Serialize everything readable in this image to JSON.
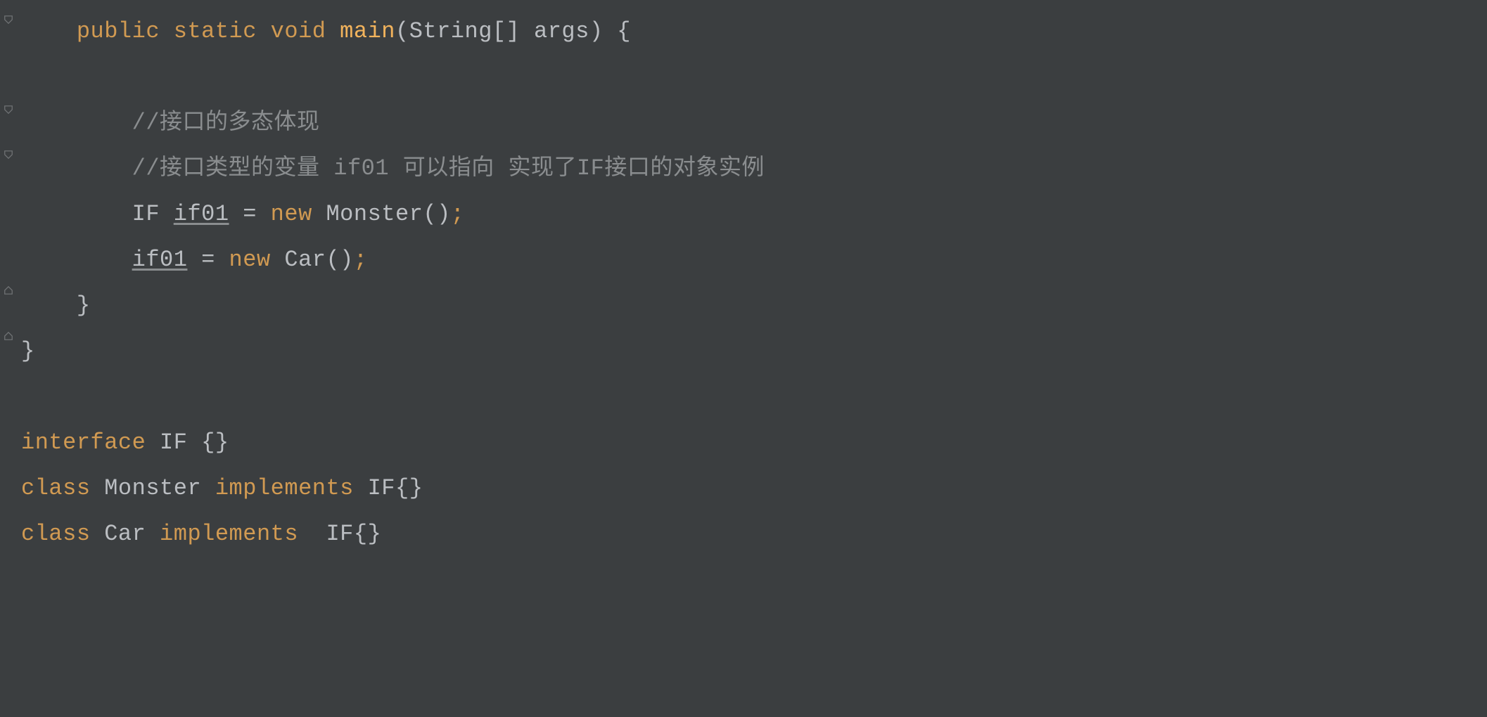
{
  "code": {
    "line1": {
      "kw_public": "public",
      "kw_static": "static",
      "kw_void": "void",
      "method": "main",
      "paren_open": "(",
      "type_string": "String",
      "brackets": "[]",
      "arg": " args",
      "paren_close": ")",
      "brace": " {"
    },
    "line3": {
      "comment_prefix": "//",
      "comment_text": "接口的多态体现"
    },
    "line4": {
      "comment_prefix": "//",
      "comment_text": "接口类型的变量 if01 可以指向 实现了IF接口的对象实例"
    },
    "line5": {
      "type": "IF ",
      "var": "if01",
      "assign": " = ",
      "kw_new": "new",
      "ctor": " Monster()",
      "semi": ";"
    },
    "line6": {
      "var": "if01",
      "assign": " = ",
      "kw_new": "new",
      "ctor": " Car()",
      "semi": ";"
    },
    "line7": {
      "brace": "}"
    },
    "line8": {
      "brace": "}"
    },
    "line10": {
      "kw_interface": "interface",
      "name": " IF ",
      "braces": "{}"
    },
    "line11": {
      "kw_class": "class",
      "name": " Monster ",
      "kw_implements": "implements",
      "impl_name": " IF",
      "braces": "{}"
    },
    "line12": {
      "kw_class": "class",
      "name": " Car ",
      "kw_implements": "implements",
      "impl_name": "  IF",
      "braces": "{}"
    }
  },
  "indent": {
    "i1": "    ",
    "i2": "        "
  }
}
